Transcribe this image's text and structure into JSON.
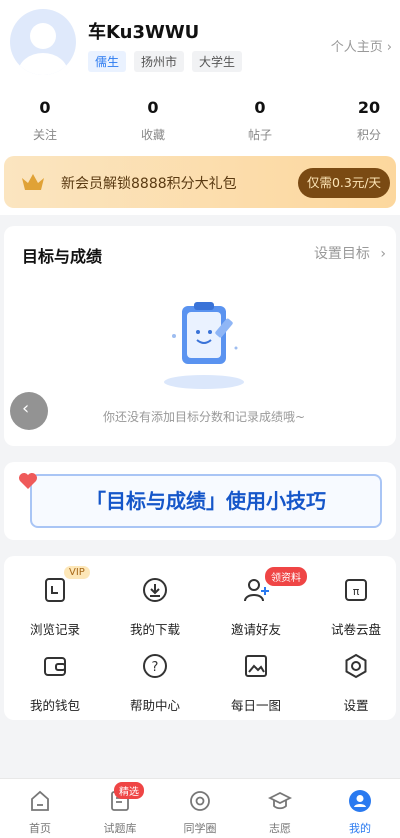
{
  "profile": {
    "username": "车Ku3WWU",
    "tags": [
      "儒生",
      "扬州市",
      "大学生"
    ],
    "home_link": "个人主页",
    "chevron": "›"
  },
  "stats": [
    {
      "value": "0",
      "label": "关注"
    },
    {
      "value": "0",
      "label": "收藏"
    },
    {
      "value": "0",
      "label": "帖子"
    },
    {
      "value": "20",
      "label": "积分"
    }
  ],
  "vip_banner": {
    "text": "新会员解锁8888积分大礼包",
    "button": "仅需0.3元/天",
    "icon": "crown-icon",
    "color": "#7a4a13"
  },
  "goals": {
    "title": "目标与成绩",
    "set_goal": "设置目标",
    "chevron": "›",
    "empty_text": "你还没有添加目标分数和记录成绩哦~",
    "back": "‹"
  },
  "tips": {
    "text": "「目标与成绩」使用小技巧"
  },
  "tools": [
    {
      "label": "浏览记录",
      "icon": "history-icon"
    },
    {
      "label": "我的下载",
      "icon": "download-icon"
    },
    {
      "label": "邀请好友",
      "icon": "invite-friend-icon"
    },
    {
      "label": "试卷云盘",
      "icon": "cloud-disk-icon"
    },
    {
      "label": "我的钱包",
      "icon": "wallet-icon"
    },
    {
      "label": "帮助中心",
      "icon": "help-icon"
    },
    {
      "label": "每日一图",
      "icon": "image-icon"
    },
    {
      "label": "设置",
      "icon": "settings-icon"
    }
  ],
  "badges": {
    "vip": "VIP",
    "invite": "领资料",
    "featured": "精选"
  },
  "tabbar": [
    {
      "label": "首页",
      "icon": "home-icon"
    },
    {
      "label": "试题库",
      "icon": "question-bank-icon"
    },
    {
      "label": "同学圈",
      "icon": "circle-icon"
    },
    {
      "label": "志愿",
      "icon": "graduation-cap-icon"
    },
    {
      "label": "我的",
      "icon": "profile-icon",
      "active": true
    }
  ],
  "colors": {
    "accent": "#2a7af0",
    "badge_red": "#ef4545"
  }
}
